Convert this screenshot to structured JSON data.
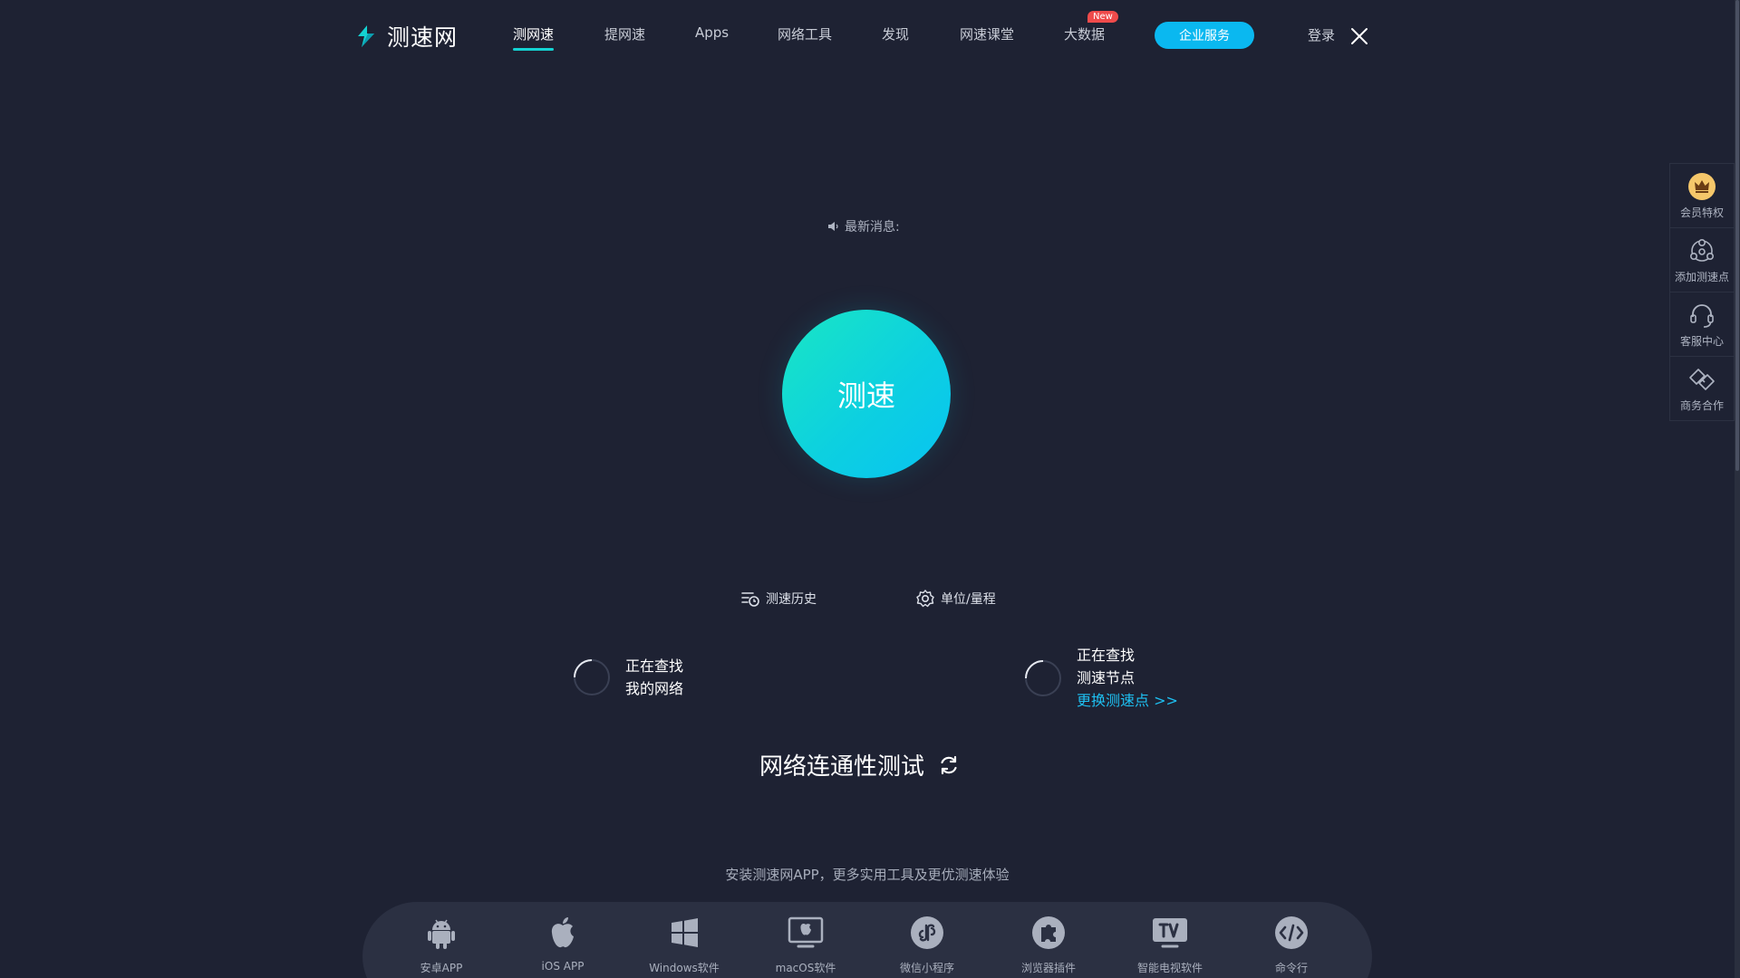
{
  "brand": {
    "logo_text": "测速网",
    "accent": "#14d2d2",
    "background": "#1e2233"
  },
  "nav": {
    "items": [
      {
        "label": "测网速",
        "active": true
      },
      {
        "label": "提网速"
      },
      {
        "label": "Apps"
      },
      {
        "label": "网络工具"
      },
      {
        "label": "发现"
      },
      {
        "label": "网速课堂"
      },
      {
        "label": "大数据"
      }
    ],
    "new_badge": "New",
    "enterprise_label": "企业服务",
    "login_label": "登录",
    "close_icon": "close-icon"
  },
  "main": {
    "notice_label": "最新消息:",
    "speed_button_label": "测速",
    "history_label": "测速历史",
    "unit_label": "单位/量程",
    "network_finder": {
      "line1": "正在查找",
      "line2": "我的网络"
    },
    "node_finder": {
      "line1": "正在查找",
      "line2": "测速节点",
      "link": "更换测速点 >>"
    },
    "connectivity_title": "网络连通性测试"
  },
  "apps": {
    "hint": "安装测速网APP，更多实用工具及更优测速体验",
    "items": [
      {
        "label": "安卓APP",
        "icon": "android-icon"
      },
      {
        "label": "iOS APP",
        "icon": "apple-icon"
      },
      {
        "label": "Windows软件",
        "icon": "windows-icon"
      },
      {
        "label": "macOS软件",
        "icon": "macos-icon"
      },
      {
        "label": "微信小程序",
        "icon": "wechat-miniprogram-icon"
      },
      {
        "label": "浏览器插件",
        "icon": "browser-plugin-icon"
      },
      {
        "label": "智能电视软件",
        "icon": "tv-icon"
      },
      {
        "label": "命令行",
        "icon": "code-icon"
      }
    ]
  },
  "sidebar": {
    "items": [
      {
        "label": "会员特权",
        "icon": "crown-icon"
      },
      {
        "label": "添加测速点",
        "icon": "add-node-icon"
      },
      {
        "label": "客服中心",
        "icon": "headset-icon"
      },
      {
        "label": "商务合作",
        "icon": "handshake-icon"
      }
    ]
  },
  "colors": {
    "speed_gradient_start": "#19e6c4",
    "speed_gradient_end": "#08c3f2",
    "link": "#1ec0f2",
    "enterprise_button": "#0ab8f0",
    "badge": "#ef4b4b"
  }
}
